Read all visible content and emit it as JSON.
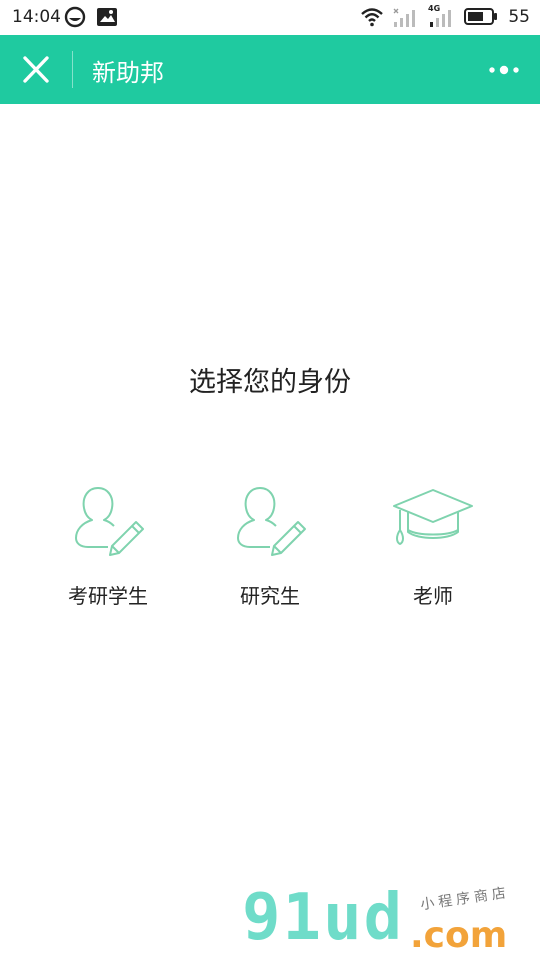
{
  "status_bar": {
    "time": "14:04",
    "battery": "55",
    "network_label": "4G",
    "icons": [
      "app-circle-icon",
      "image-icon",
      "wifi-icon",
      "signal-icon",
      "signal-4g-icon",
      "battery-icon"
    ]
  },
  "header": {
    "title": "新助邦",
    "close_icon": "close-icon",
    "more_icon": "more-icon",
    "color": "#1fcaa0"
  },
  "main": {
    "title": "选择您的身份",
    "options": [
      {
        "label": "考研学生",
        "icon": "student-pencil-icon"
      },
      {
        "label": "研究生",
        "icon": "student-pencil-icon"
      },
      {
        "label": "老师",
        "icon": "graduation-cap-icon"
      }
    ],
    "icon_color": "#7fd3ae"
  },
  "watermark": {
    "brand": "91ud",
    "domain": ".com",
    "tagline": "小程序商店"
  }
}
